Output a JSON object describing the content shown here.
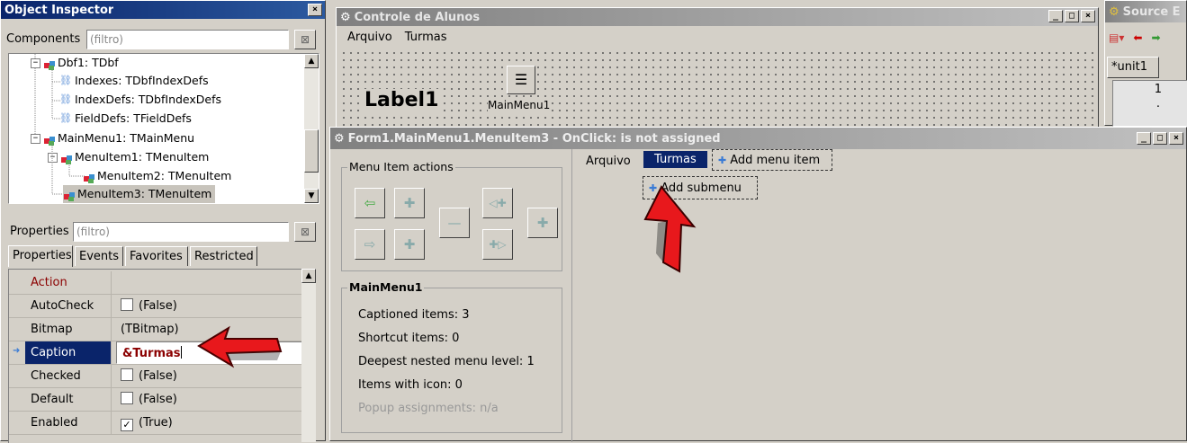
{
  "object_inspector": {
    "title": "Object Inspector",
    "components_label": "Components",
    "components_placeholder": "(filtro)",
    "tree": [
      {
        "label": "Dbf1: TDbf",
        "kind": "component"
      },
      {
        "label": "Indexes: TDbfIndexDefs",
        "kind": "leaf"
      },
      {
        "label": "IndexDefs: TDbfIndexDefs",
        "kind": "leaf"
      },
      {
        "label": "FieldDefs: TFieldDefs",
        "kind": "leaf"
      },
      {
        "label": "MainMenu1: TMainMenu",
        "kind": "component"
      },
      {
        "label": "MenuItem1: TMenuItem",
        "kind": "component"
      },
      {
        "label": "MenuItem2: TMenuItem",
        "kind": "component"
      },
      {
        "label": "MenuItem3: TMenuItem",
        "kind": "component",
        "selected": true
      }
    ],
    "properties_label": "Properties",
    "properties_placeholder": "(filtro)",
    "tabs": [
      "Properties",
      "Events",
      "Favorites",
      "Restricted"
    ],
    "properties": [
      {
        "name": "Action",
        "value": "",
        "category": true
      },
      {
        "name": "AutoCheck",
        "value": "(False)",
        "checkbox": "unchecked"
      },
      {
        "name": "Bitmap",
        "value": "(TBitmap)"
      },
      {
        "name": "Caption",
        "value": "&Turmas",
        "selected": true
      },
      {
        "name": "Checked",
        "value": "(False)",
        "checkbox": "unchecked"
      },
      {
        "name": "Default",
        "value": "(False)",
        "checkbox": "unchecked"
      },
      {
        "name": "Enabled",
        "value": "(True)",
        "checkbox": "checked"
      }
    ],
    "check_mark": "✓"
  },
  "form_window": {
    "title": "Controle de Alunos",
    "menu": [
      "Arquivo",
      "Turmas"
    ],
    "label_component": "Label1",
    "mainmenu_component": "MainMenu1"
  },
  "source_editor": {
    "title": "Source E",
    "tab": "*unit1",
    "line_number": "1",
    "line_marker": "·"
  },
  "menu_editor": {
    "title": "Form1.MainMenu1.MenuItem3 - OnClick: is not assigned",
    "actions_group": "Menu Item actions",
    "action_glyphs": {
      "move_left": "⇦",
      "add_above": "✚",
      "move_right": "⇨",
      "add_below": "✚",
      "delete": "—",
      "add_left": "◁✚",
      "add_right": "✚▷",
      "add_sub": "✚"
    },
    "stats_group": "MainMenu1",
    "stats": [
      "Captioned items: 3",
      "Shortcut items: 0",
      "Deepest nested menu level: 1",
      "Items with icon: 0"
    ],
    "popup_assignments": "Popup assignments: n/a",
    "preview_menu": [
      "Arquivo",
      "Turmas"
    ],
    "add_menu_item": "Add menu item",
    "add_submenu": "Add submenu",
    "plus_glyph": "✚"
  },
  "window_buttons": {
    "minimize": "_",
    "maximize": "□",
    "close": "×"
  },
  "colors": {
    "title_active": "#0a246a",
    "selection": "#0a246a",
    "annotation_arrow": "#e8181c",
    "category_text": "#8b0000"
  }
}
